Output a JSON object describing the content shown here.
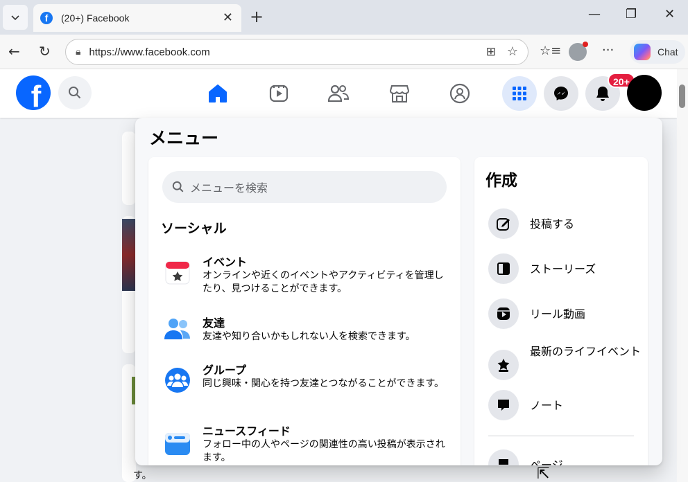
{
  "browser": {
    "tab_title": "(20+) Facebook",
    "url": "https://www.facebook.com",
    "copilot_label": "Chat"
  },
  "header": {
    "notification_badge": "20+",
    "icons": [
      "facebook-logo-icon",
      "search-icon",
      "home-icon",
      "video-icon",
      "friends-icon",
      "marketplace-icon",
      "groups-icon",
      "menu-grid-icon",
      "messenger-icon",
      "bell-icon"
    ]
  },
  "menu": {
    "title": "メニュー",
    "search_placeholder": "メニューを検索",
    "social_heading": "ソーシャル",
    "items": [
      {
        "title": "イベント",
        "desc": "オンラインや近くのイベントやアクティビティを管理したり、見つけることができます。"
      },
      {
        "title": "友達",
        "desc": "友達や知り合いかもしれない人を検索できます。"
      },
      {
        "title": "グループ",
        "desc": "同じ興味・関心を持つ友達とつながることができます。"
      },
      {
        "title": "ニュースフィード",
        "desc": "フォロー中の人やページの関連性の高い投稿が表示されます。"
      }
    ]
  },
  "create": {
    "title": "作成",
    "items": [
      {
        "label": "投稿する"
      },
      {
        "label": "ストーリーズ"
      },
      {
        "label": "リール動画"
      },
      {
        "label": "最新のライフイベント"
      },
      {
        "label": "ノート"
      },
      {
        "label": "ページ"
      }
    ]
  },
  "feed": {
    "tail_text": "す。"
  },
  "colors": {
    "facebook_blue": "#0866ff",
    "badge_red": "#e41e3f",
    "page_bg": "#f0f2f5"
  }
}
